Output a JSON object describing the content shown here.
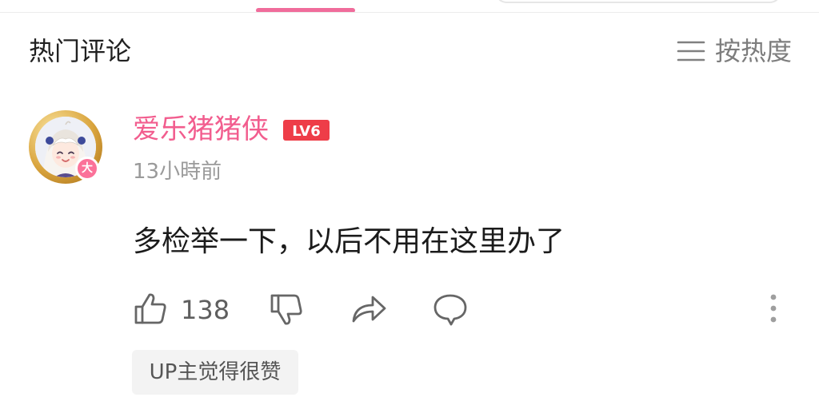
{
  "header": {
    "section_title": "热门评论",
    "sort_label": "按热度"
  },
  "comment": {
    "username": "爱乐猪猪侠",
    "level": "LV6",
    "avatar_badge": "大",
    "timestamp": "13小時前",
    "text": "多检举一下，以后不用在这里办了",
    "like_count": "138",
    "up_tag": "UP主觉得很赞"
  },
  "icons": {
    "sort": "list-sort-icon",
    "like": "thumbs-up-icon",
    "dislike": "thumbs-down-icon",
    "share": "share-arrow-icon",
    "reply": "speech-bubble-icon",
    "more": "vertical-dots-icon"
  },
  "colors": {
    "accent": "#fb7299",
    "username": "#f25d8e",
    "level_badge": "#ee3d48",
    "tab_indicator": "#f06c9b"
  }
}
